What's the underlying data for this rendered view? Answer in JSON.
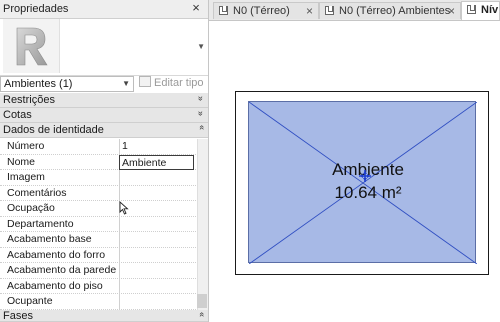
{
  "properties_panel": {
    "title": "Propriedades",
    "close_glyph": "×",
    "filter_value": "Ambientes (1)",
    "edit_type_label": "Editar tipo",
    "categories": {
      "restricoes": "Restrições",
      "cotas": "Cotas",
      "dados_identidade": "Dados de identidade",
      "fases": "Fases"
    },
    "collapse_glyph": "»",
    "expand_glyph": "»",
    "rows": [
      {
        "name": "Número",
        "value": "1"
      },
      {
        "name": "Nome",
        "value": "Ambiente"
      },
      {
        "name": "Imagem",
        "value": ""
      },
      {
        "name": "Comentários",
        "value": ""
      },
      {
        "name": "Ocupação",
        "value": ""
      },
      {
        "name": "Departamento",
        "value": ""
      },
      {
        "name": "Acabamento base",
        "value": ""
      },
      {
        "name": "Acabamento do forro",
        "value": ""
      },
      {
        "name": "Acabamento da parede",
        "value": ""
      },
      {
        "name": "Acabamento do piso",
        "value": ""
      },
      {
        "name": "Ocupante",
        "value": ""
      }
    ]
  },
  "view_tabs": [
    {
      "label": "N0 (Térreo)",
      "close": "×"
    },
    {
      "label": "N0 (Térreo) Ambientes",
      "close": "×"
    },
    {
      "label": "Nív",
      "close": ""
    }
  ],
  "room": {
    "name": "Ambiente",
    "area": "10.64 m²"
  },
  "colors": {
    "room_fill": "#a7b9e6",
    "room_lines": "#2f4ec2",
    "tag_color": "#1f3fcf"
  },
  "icons": {
    "revit_logo": "revit-r-logo",
    "view_tab_icon": "floor-plan-view-icon"
  }
}
